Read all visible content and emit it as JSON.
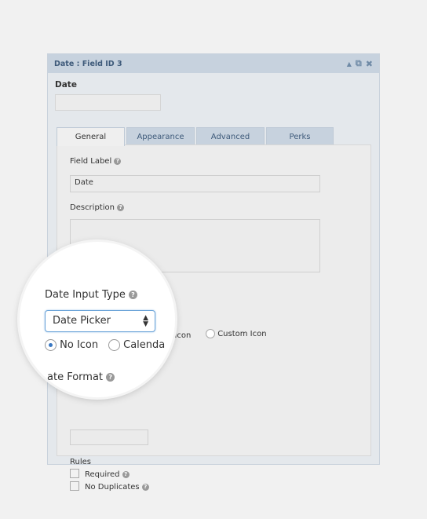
{
  "panel": {
    "title": "Date : Field ID 3",
    "icons": [
      "collapse-arrow-icon",
      "duplicate-icon",
      "close-icon"
    ]
  },
  "preview": {
    "label": "Date",
    "value": ""
  },
  "tabs": [
    {
      "label": "General",
      "active": true
    },
    {
      "label": "Appearance"
    },
    {
      "label": "Advanced"
    },
    {
      "label": "Perks"
    }
  ],
  "general": {
    "field_label": {
      "label": "Field Label",
      "value": "Date"
    },
    "description": {
      "label": "Description",
      "value": ""
    },
    "date_input_type": {
      "label": "Date Input Type",
      "value": "Date Picker"
    },
    "icon_options": [
      {
        "label": "No Icon",
        "checked": true
      },
      {
        "label": "Calendar Icon",
        "checked": false
      },
      {
        "label": "Custom Icon",
        "checked": false
      }
    ],
    "icon_partial": "ar Icon",
    "icon_partial_mag": "Calenda",
    "date_format": {
      "label": "Date Format",
      "label_partial": "ate Format"
    },
    "rules": {
      "label": "Rules",
      "items": [
        {
          "label": "Required",
          "checked": false
        },
        {
          "label": "No Duplicates",
          "checked": false
        }
      ]
    }
  },
  "help_glyph": "?",
  "colors": {
    "header": "#c7d2de",
    "accent": "#3a78c2"
  }
}
